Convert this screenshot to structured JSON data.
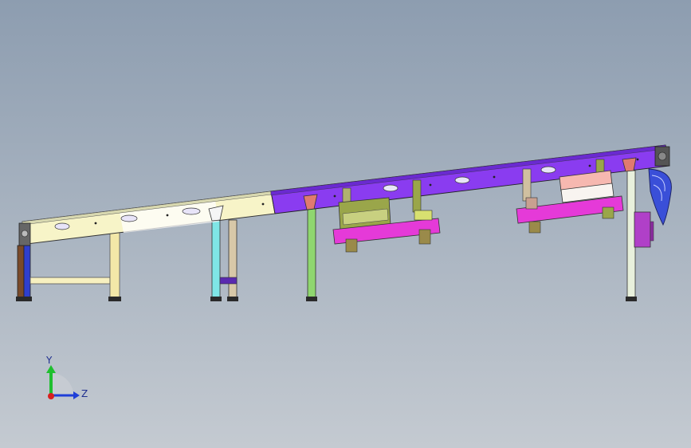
{
  "viewport": {
    "background_top": "#8d9db0",
    "background_bottom": "#c4cad1"
  },
  "triad": {
    "y_label": "Y",
    "z_label": "Z",
    "y_color": "#1fbf2f",
    "z_color": "#1f3fd8",
    "x_color": "#d81f1f"
  },
  "model": {
    "conveyor_colors": {
      "low_section": "#f7f4c8",
      "mid_section": "#ffffff",
      "high_section": "#8a3cf0",
      "fixture_magenta": "#e53ad8",
      "fixture_olive": "#9aa64a",
      "pink_block": "#f6b8b0",
      "leg_blue": "#2f3fcf",
      "leg_green": "#8fd66f",
      "leg_cyan": "#7fe6e6",
      "leg_tan": "#f0e2a0",
      "drive_purple": "#b040c8",
      "nose_blue": "#3a4fd8"
    }
  }
}
